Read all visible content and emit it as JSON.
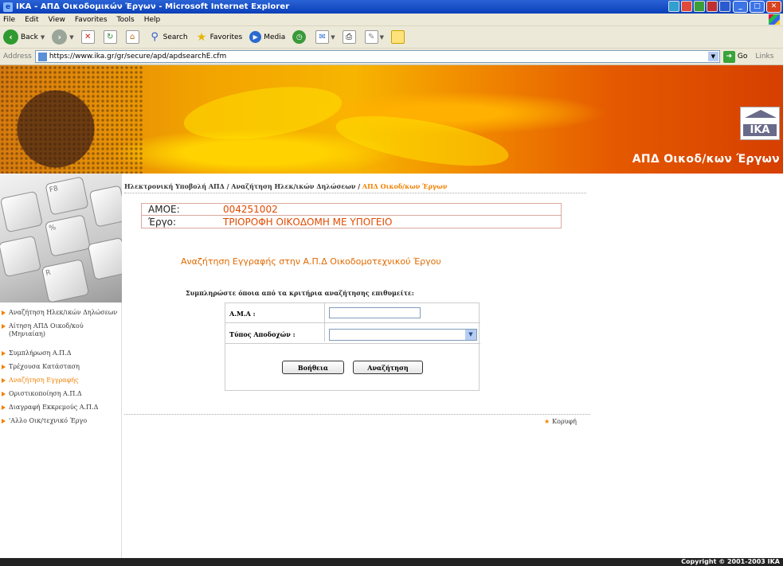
{
  "window": {
    "title": "IKA - ΑΠΔ Οικοδομικών Έργων - Microsoft Internet Explorer",
    "minimize": "_",
    "maximize": "□",
    "close": "✕"
  },
  "menu": [
    "File",
    "Edit",
    "View",
    "Favorites",
    "Tools",
    "Help"
  ],
  "toolbar": {
    "back": "Back",
    "search": "Search",
    "favorites": "Favorites",
    "media": "Media"
  },
  "address": {
    "label": "Address",
    "url": "https://www.ika.gr/gr/secure/apd/apdsearchE.cfm",
    "go": "Go",
    "links": "Links"
  },
  "banner": {
    "logo_text": "IKA",
    "title": "ΑΠΔ Οικοδ/κων Έργων"
  },
  "sidebar": {
    "items": [
      {
        "label": "Αναζήτηση Ηλεκ/ικών Δηλώσεων",
        "active": false
      },
      {
        "label": "Αίτηση ΑΠΔ Οικοδ/κού (Μηνιαίαη)",
        "active": false
      },
      {
        "label": "Συμπλήρωση Α.Π.Δ",
        "active": false
      },
      {
        "label": "Τρέχουσα Κατάσταση",
        "active": false
      },
      {
        "label": "Αναζήτηση Εγγραφής",
        "active": true
      },
      {
        "label": "Οριστικοποίηση Α.Π.Δ",
        "active": false
      },
      {
        "label": "Διαγραφή Εκκρεμούς Α.Π.Δ",
        "active": false
      },
      {
        "label": "'Αλλο Οικ/τεχνικό Έργο",
        "active": false
      }
    ]
  },
  "breadcrumb": {
    "part1": "Ηλεκτρονική Υποβολή ΑΠΔ / Αναζήτηση Ηλεκ/ικών Δηλώσεων / ",
    "current": "ΑΠΔ Οικοδ/κων Έργων"
  },
  "info": {
    "ame_label": "ΑΜΟΕ:",
    "ame_value": "004251002",
    "ergo_label": "Έργο:",
    "ergo_value": "ΤΡΙΟΡΟΦΗ ΟΙΚΟΔΟΜΗ ΜΕ ΥΠΟΓΕΙΟ"
  },
  "form": {
    "heading": "Αναζήτηση Εγγραφής στην Α.Π.Δ Οικοδομοτεχνικού Έργου",
    "instructions": "Συμπληρώστε όποια από τα κριτήρια αναζήτησης επιθυμείτε:",
    "ama_label": "Α.Μ.Α :",
    "ama_value": "",
    "apodoxes_label": "Τύπος Αποδοχών :",
    "apodoxes_selected": "",
    "help_button": "Βοήθεια",
    "search_button": "Αναζήτηση"
  },
  "home_link": "Κορυφή",
  "footer": "Copyright © 2001-2003 IKA",
  "colors": {
    "accent": "#f08000",
    "title_bar": "#0b3fb8",
    "value_text": "#e04a00"
  }
}
